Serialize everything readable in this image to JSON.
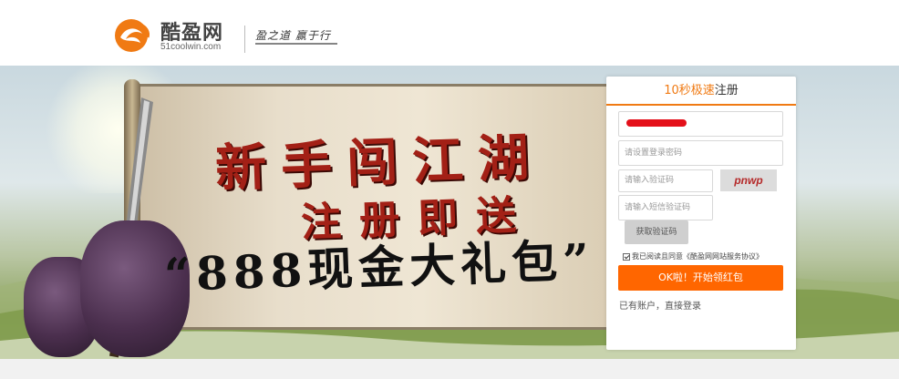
{
  "header": {
    "site_name": "酷盈网",
    "site_domain": "51coolwin.com",
    "slogan": "盈之道  赢于行"
  },
  "banner": {
    "line1": "新手闯江湖",
    "line2": "注册即送",
    "line3": "“888现金大礼包”"
  },
  "register": {
    "title_accent": "10秒极速",
    "title_rest": "注册",
    "phone_value_redacted": true,
    "password_placeholder": "请设置登录密码",
    "captcha_placeholder": "请输入验证码",
    "captcha_image_text": "pnwp",
    "sms_placeholder": "请输入短信验证码",
    "sms_button": "获取验证码",
    "agree_text": "我已阅读且同意《酷盈网网站服务协议》",
    "submit_label": "OK啦！开始领红包",
    "login_link": "已有账户，直接登录"
  },
  "colors": {
    "accent": "#f07a13",
    "button": "#ff6600",
    "promo_red": "#a32016"
  }
}
